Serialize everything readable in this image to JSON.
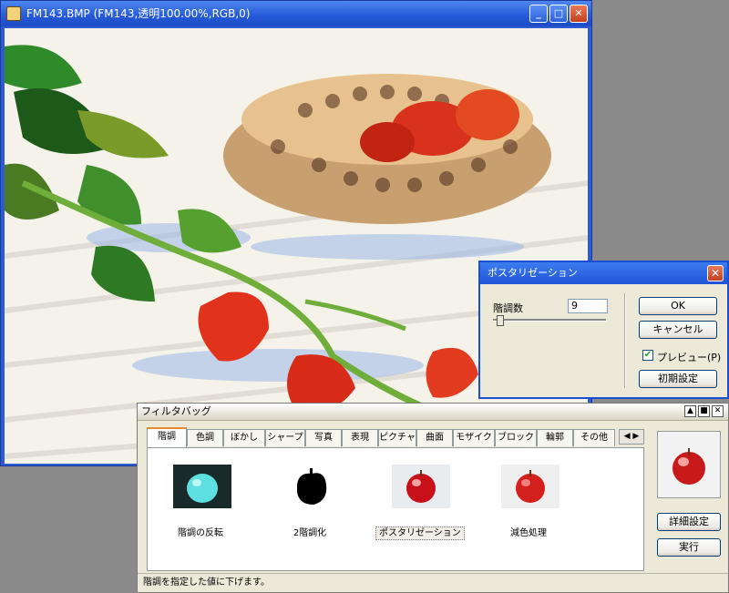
{
  "image_window": {
    "title": "FM143.BMP (FM143,透明100.00%,RGB,0)",
    "buttons": {
      "minimize": "_",
      "maximize": "□",
      "close": "✕"
    }
  },
  "posterize_dialog": {
    "title": "ポスタリゼーション",
    "levels_label": "階調数",
    "levels_value": "9",
    "levels_fraction": 0.05,
    "ok_label": "OK",
    "cancel_label": "キャンセル",
    "preview_label": "プレビュー(P)",
    "preview_checked": true,
    "reset_label": "初期設定",
    "close": "✕"
  },
  "filter_bag": {
    "title": "フィルタバッグ",
    "tabs": [
      "階調",
      "色調",
      "ぼかし",
      "シャープ",
      "写真",
      "表現",
      "ピクチャ",
      "曲面",
      "モザイク",
      "ブロック",
      "輪郭",
      "その他"
    ],
    "tab_scroll": "◀ ▶",
    "active_tab": 0,
    "items": [
      {
        "label": "階調の反転"
      },
      {
        "label": "2階調化"
      },
      {
        "label": "ポスタリゼーション",
        "selected": true
      },
      {
        "label": "減色処理"
      }
    ],
    "detail_button": "詳細設定",
    "run_button": "実行",
    "status": "階調を指定した値に下げます。"
  },
  "colors": {
    "titlebar": "#2559d8",
    "dialog_bg": "#ece9d8",
    "tab_highlight": "#e68b2c"
  }
}
